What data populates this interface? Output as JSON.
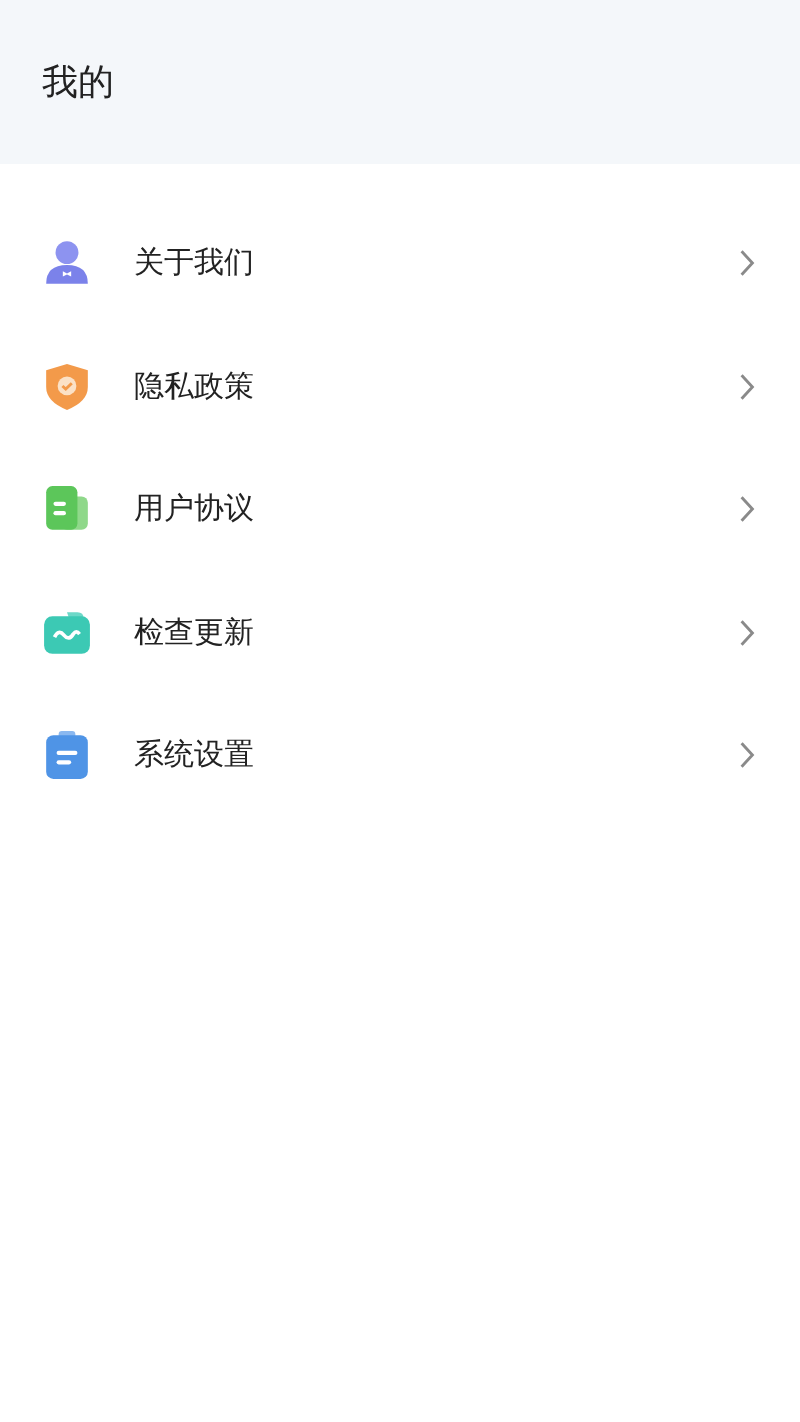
{
  "header": {
    "title": "我的"
  },
  "menu": [
    {
      "kind": "person",
      "label": "关于我们"
    },
    {
      "kind": "shield",
      "label": "隐私政策"
    },
    {
      "kind": "document",
      "label": "用户协议"
    },
    {
      "kind": "wave",
      "label": "检查更新"
    },
    {
      "kind": "clipboard",
      "label": "系统设置"
    }
  ]
}
